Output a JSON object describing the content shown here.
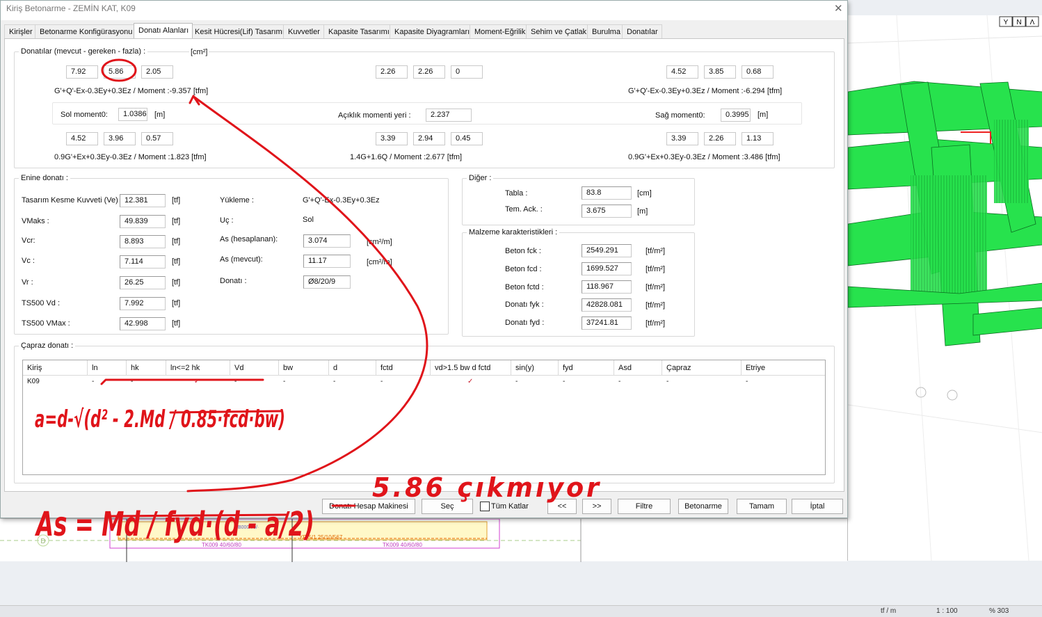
{
  "window": {
    "title": "Kiriş Betonarme - ZEMİN KAT, K09",
    "close": "✕"
  },
  "tabs": [
    {
      "label": "Kirişler"
    },
    {
      "label": "Betonarme Konfigürasyonu"
    },
    {
      "label": "Donatı Alanları"
    },
    {
      "label": "Kesit Hücresi(Lif) Tasarımı"
    },
    {
      "label": "Kuvvetler"
    },
    {
      "label": "Kapasite Tasarımı"
    },
    {
      "label": "Kapasite Diyagramları"
    },
    {
      "label": "Moment-Eğrilik"
    },
    {
      "label": "Sehim ve Çatlak"
    },
    {
      "label": "Burulma"
    },
    {
      "label": "Donatılar"
    }
  ],
  "donatilar": {
    "title": "Donatılar (mevcut - gereken - fazla) :",
    "unit": "[cm²]",
    "top_left": [
      "7.92",
      "5.86",
      "2.05"
    ],
    "top_mid": [
      "2.26",
      "2.26",
      "0"
    ],
    "top_right": [
      "4.52",
      "3.85",
      "0.68"
    ],
    "combo_top_left": "G'+Q'-Ex-0.3Ey+0.3Ez  / Moment :-9.357 [tfm]",
    "combo_top_right": "G'+Q'-Ex-0.3Ey+0.3Ez  / Moment :-6.294 [tfm]",
    "sol_label": "Sol moment0:",
    "sol_value": "1.0386",
    "sol_unit": "[m]",
    "aciklik_label": "Açıklık momenti yeri :",
    "aciklik_value": "2.237",
    "sag_label": "Sağ moment0:",
    "sag_value": "0.3995",
    "sag_unit": "[m]",
    "bot_left": [
      "4.52",
      "3.96",
      "0.57"
    ],
    "bot_mid": [
      "3.39",
      "2.94",
      "0.45"
    ],
    "bot_right": [
      "3.39",
      "2.26",
      "1.13"
    ],
    "combo_bot_left": "0.9G'+Ex+0.3Ey-0.3Ez  / Moment :1.823 [tfm]",
    "combo_bot_mid": "1.4G+1.6Q  / Moment :2.677 [tfm]",
    "combo_bot_right": "0.9G'+Ex+0.3Ey-0.3Ez  / Moment :3.486 [tfm]"
  },
  "enine": {
    "title": "Enine donatı :",
    "rows": [
      {
        "label": "Tasarım Kesme Kuvveti (Ve)",
        "value": "12.381",
        "unit": "[tf]"
      },
      {
        "label": "VMaks :",
        "value": "49.839",
        "unit": "[tf]"
      },
      {
        "label": "Vcr:",
        "value": "8.893",
        "unit": "[tf]"
      },
      {
        "label": "Vc :",
        "value": "7.114",
        "unit": "[tf]"
      },
      {
        "label": "Vr :",
        "value": "26.25",
        "unit": "[tf]"
      },
      {
        "label": "TS500 Vd :",
        "value": "7.992",
        "unit": "[tf]"
      },
      {
        "label": "TS500 VMax :",
        "value": "42.998",
        "unit": "[tf]"
      }
    ],
    "yukleme_label": "Yükleme :",
    "yukleme_value": "G'+Q'-Ex-0.3Ey+0.3Ez",
    "uc_label": "Uç :",
    "uc_value": "Sol",
    "as_hesap_label": "As (hesaplanan):",
    "as_hesap_value": "3.074",
    "as_hesap_unit": "[cm²/m]",
    "as_mevcut_label": "As (mevcut):",
    "as_mevcut_value": "11.17",
    "as_mevcut_unit": "[cm²/m]",
    "donati_label": "Donatı :",
    "donati_value": "Ø8/20/9"
  },
  "diger": {
    "title": "Diğer :",
    "tabla_label": "Tabla :",
    "tabla_value": "83.8",
    "tabla_unit": "[cm]",
    "temack_label": "Tem. Ack. :",
    "temack_value": "3.675",
    "temack_unit": "[m]"
  },
  "malzeme": {
    "title": "Malzeme karakteristikleri :",
    "rows": [
      {
        "label": "Beton fck :",
        "value": "2549.291",
        "unit": "[tf/m²]"
      },
      {
        "label": "Beton fcd :",
        "value": "1699.527",
        "unit": "[tf/m²]"
      },
      {
        "label": "Beton fctd :",
        "value": "118.967",
        "unit": "[tf/m²]"
      },
      {
        "label": "Donatı fyk :",
        "value": "42828.081",
        "unit": "[tf/m²]"
      },
      {
        "label": "Donatı fyd :",
        "value": "37241.81",
        "unit": "[tf/m²]"
      }
    ]
  },
  "capraz": {
    "title": "Çapraz donatı :",
    "headers": [
      "Kiriş",
      "ln",
      "hk",
      "ln<=2 hk",
      "Vd",
      "bw",
      "d",
      "fctd",
      "vd>1.5 bw d fctd",
      "sin(y)",
      "fyd",
      "Asd",
      "Çapraz",
      "Etriye"
    ],
    "row": [
      "K09",
      "-",
      "-",
      "✓",
      "-",
      "-",
      "-",
      "-",
      "✓",
      "-",
      "-",
      "-",
      "-",
      "-"
    ]
  },
  "buttons": {
    "hesap": "Donatı Hesap Makinesi",
    "sec": "Seç",
    "tum_katlar": "Tüm Katlar",
    "prev": "<<",
    "next": ">>",
    "filtre": "Filtre",
    "betonarme": "Betonarme",
    "tamam": "Tamam",
    "iptal": "İptal"
  },
  "background": {
    "plan_labels": [
      "TK009 40/60/80",
      "TK009 40/60/80",
      "YP·5/1 25/10/567",
      "B000/70/·"
    ],
    "axis_d": "D",
    "view_buttons": [
      "Y",
      "N",
      "Λ"
    ]
  },
  "status": {
    "unit": "tf / m",
    "scale": "1 : 100",
    "zoom": "% 303"
  },
  "handwriting": {
    "formula_a": "a=d-√(d² - 2.Md / 0.85·fcd·bw)",
    "formula_as": "As = Md / fyd·(d - a/2)",
    "note": "5.86 çıkmıyor"
  },
  "colors": {
    "annotation": "#e0141a",
    "beam": "#22e04a",
    "accent": "#0a64c8"
  }
}
